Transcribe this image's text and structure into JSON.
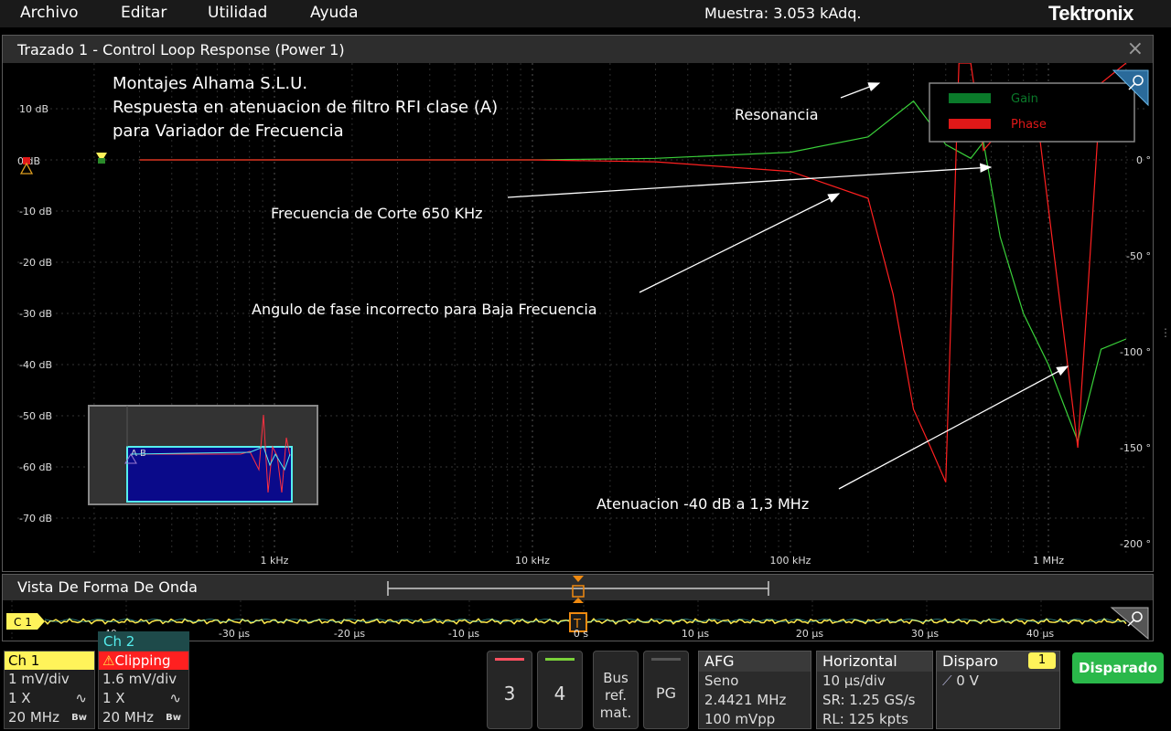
{
  "menu": {
    "items": [
      "Archivo",
      "Editar",
      "Utilidad",
      "Ayuda"
    ],
    "sample": "Muestra: 3.053 kAdq.",
    "logo": "Tektronix"
  },
  "plot": {
    "title": "Trazado 1 - Control Loop Response (Power 1)",
    "close": "×",
    "annotation_title": [
      "Montajes Alhama S.L.U.",
      "Respuesta en atenuacion de filtro RFI clase (A)",
      "para Variador de Frecuencia"
    ],
    "annotations": [
      "Resonancia",
      "Frecuencia de Corte 650 KHz",
      "Angulo de fase incorrecto para Baja Frecuencia",
      "Atenuacion -40 dB a 1,3 MHz"
    ],
    "legend": [
      "Gain",
      "Phase"
    ],
    "colors": {
      "gain": "#3ad13a",
      "phase": "#ff2020",
      "legend_gain": "#0a7a2a",
      "legend_phase": "#e01818"
    },
    "zero_marker": "0 dB",
    "overview_marker": "A B"
  },
  "chart_data": {
    "type": "line",
    "x_scale": "log",
    "x_ticks": [
      "1 kHz",
      "10 kHz",
      "100 kHz",
      "1 MHz"
    ],
    "y_left_ticks": [
      "10 dB",
      "0 dB",
      "-10 dB",
      "-20 dB",
      "-30 dB",
      "-40 dB",
      "-50 dB",
      "-60 dB",
      "-70 dB"
    ],
    "y_right_ticks": [
      "0 °",
      "-50 °",
      "-100 °",
      "-150 °",
      "-200 °"
    ],
    "y_left_range": [
      -80,
      20
    ],
    "y_right_range": [
      -220,
      40
    ],
    "series": [
      {
        "name": "Gain",
        "x": [
          100,
          300,
          1000,
          3000,
          10000,
          30000,
          100000,
          200000,
          300000,
          400000,
          500000,
          560000,
          650000,
          800000,
          1000000,
          1300000,
          1600000,
          2000000
        ],
        "y": [
          0,
          0,
          0,
          0,
          0,
          0.3,
          1.5,
          4.5,
          11.5,
          3,
          0.3,
          3.5,
          -15,
          -30,
          -40,
          -55,
          -37,
          -35
        ]
      },
      {
        "name": "Phase",
        "x": [
          100,
          300,
          1000,
          3000,
          10000,
          30000,
          100000,
          200000,
          250000,
          300000,
          350000,
          400000,
          450000,
          500000,
          560000,
          700000,
          900000,
          1300000,
          1600000,
          2000000
        ],
        "y": [
          0,
          0,
          0,
          0,
          0,
          -1,
          -6,
          -20,
          -70,
          -130,
          -150,
          -168,
          90,
          95,
          5,
          20,
          25,
          -150,
          40,
          90
        ]
      }
    ]
  },
  "waveform": {
    "title": "Vista De Forma De Onda",
    "ch_label": "C 1",
    "trigger_label": "T",
    "time_ticks": [
      "-30 µs",
      "-20 µs",
      "-10 µs",
      "0 s",
      "10 µs",
      "20 µs",
      "30 µs",
      "40 µs"
    ],
    "left_tick": "40 µs"
  },
  "channels": {
    "ch1": {
      "head": "Ch 1",
      "scale": "1 mV/div",
      "probe": "1 X",
      "bw": "20 MHz",
      "bw_icon": "Bw",
      "color": "#fff35a"
    },
    "ch2": {
      "tab": "Ch 2",
      "head": "Clipping",
      "scale": "1.6 mV/div",
      "probe": "1 X",
      "bw": "20 MHz",
      "bw_icon": "Bw",
      "color": "#ff2020"
    }
  },
  "buttons": {
    "ch3": "3",
    "ch4": "4",
    "bus_ref": [
      "Bus",
      "ref.",
      "mat."
    ],
    "pg": "PG"
  },
  "afg": {
    "head": "AFG",
    "wave": "Seno",
    "freq": "2.4421 MHz",
    "amp": "100 mVpp"
  },
  "horizontal": {
    "head": "Horizontal",
    "scale": "10 µs/div",
    "sr": "SR: 1.25 GS/s",
    "rl": "RL: 125 kpts"
  },
  "trigger": {
    "head": "Disparo",
    "badge": "1",
    "level": "0 V"
  },
  "run": {
    "label": "Disparado"
  }
}
